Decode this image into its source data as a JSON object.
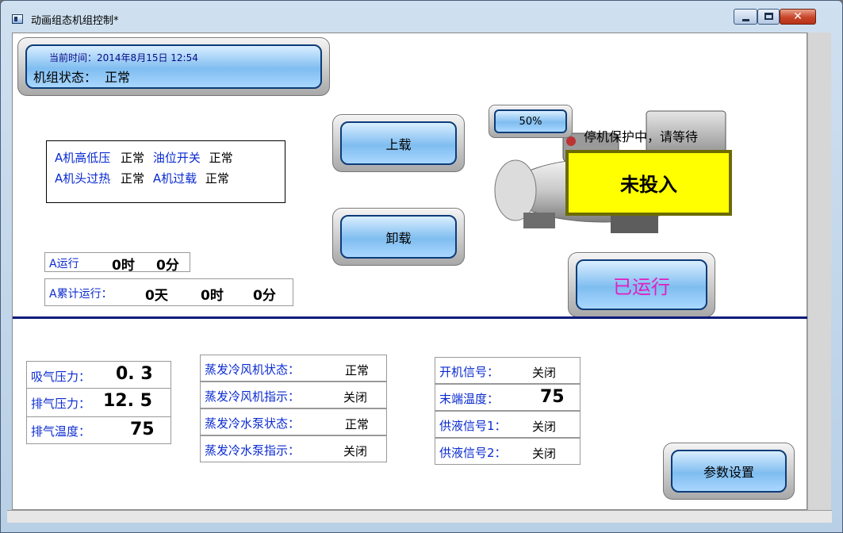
{
  "window": {
    "title": "动画组态机组控制*",
    "close_glyph": "✕"
  },
  "header": {
    "time_label": "当前时间：",
    "time_value": "2014年8月15日 12:54",
    "status_label": "机组状态：",
    "status_value": "正常"
  },
  "alarms": {
    "row1": {
      "label1": "A机高低压",
      "value1": "正常",
      "label2": "油位开关",
      "value2": "正常"
    },
    "row2": {
      "label1": "A机头过热",
      "value1": "正常",
      "label2": "A机过载",
      "value2": "正常"
    }
  },
  "controls": {
    "load_label": "上载",
    "unload_label": "卸载",
    "percent_label": "50%",
    "running_label": "已运行",
    "params_label": "参数设置"
  },
  "compressor": {
    "stop_text": "停机保护中，请等待",
    "status_text": "未投入"
  },
  "run_a": {
    "label": "A运行",
    "hours": "0时",
    "minutes": "0分"
  },
  "run_total": {
    "label": "A累计运行：",
    "days": "0天",
    "hours": "0时",
    "minutes": "0分"
  },
  "pressure": {
    "suction_label": "吸气压力：",
    "suction_value": "0. 3",
    "discharge_label": "排气压力：",
    "discharge_value": "12. 5",
    "temp_label": "排气温度：",
    "temp_value": "75"
  },
  "evap": [
    {
      "label": "蒸发冷风机状态：",
      "value": "正常"
    },
    {
      "label": "蒸发冷风机指示：",
      "value": "关闭"
    },
    {
      "label": "蒸发冷水泵状态：",
      "value": "正常"
    },
    {
      "label": "蒸发冷水泵指示：",
      "value": "关闭"
    }
  ],
  "signals": [
    {
      "label": "开机信号：",
      "value": "关闭"
    },
    {
      "label": "末端温度：",
      "value": "75"
    },
    {
      "label": "供液信号1：",
      "value": "关闭"
    },
    {
      "label": "供液信号2：",
      "value": "关闭"
    }
  ]
}
